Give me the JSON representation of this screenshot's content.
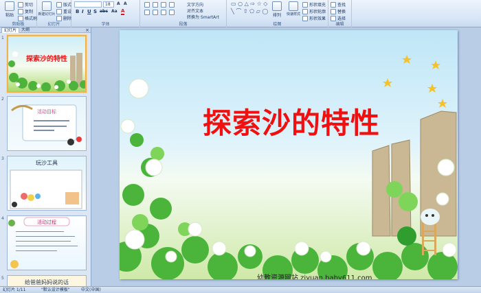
{
  "ribbon": {
    "groups": {
      "clipboard": "剪贴板",
      "slides": "幻灯片",
      "font": "字体",
      "paragraph": "段落",
      "drawing": "绘图",
      "editing": "编辑"
    },
    "paste_label": "粘贴",
    "cut_label": "剪切",
    "copy_label": "复制",
    "format_painter_label": "格式刷",
    "new_slide_label": "新建幻灯片",
    "layout_label": "版式",
    "reset_label": "重设",
    "delete_label": "删除",
    "font_size_value": "18",
    "text_direction_label": "文字方向",
    "align_text_label": "对齐文本",
    "smartart_label": "转换为 SmartArt",
    "arrange_label": "排列",
    "quick_styles_label": "快速样式",
    "shape_fill_label": "形状填充",
    "shape_outline_label": "形状轮廓",
    "shape_effects_label": "形状效果",
    "find_label": "查找",
    "replace_label": "替换",
    "select_label": "选择",
    "format_bold": "B",
    "format_italic": "I",
    "format_underline": "U",
    "format_strike": "S",
    "format_abc": "abc",
    "format_font_color": "A",
    "format_aa": "Aa"
  },
  "panel": {
    "tab_slides": "幻灯片",
    "tab_outline": "大纲"
  },
  "thumbnails": [
    {
      "number": "1",
      "title": "探索沙的特性"
    },
    {
      "number": "2",
      "title": "活动目标"
    },
    {
      "number": "3",
      "title": "玩沙工具"
    },
    {
      "number": "4",
      "title": "活动过程"
    },
    {
      "number": "5",
      "title": "给爸爸妈妈说的话"
    }
  ],
  "slide": {
    "title": "探索沙的特性",
    "footer": "幼教资源网站 ziyuan.baby611.com"
  },
  "status": {
    "slide_count": "幻灯片 1/11",
    "theme": "\"默认设计模板\"",
    "language": "中文(中国)"
  },
  "colors": {
    "title_red": "#f01010",
    "selected_border": "#f2b24a",
    "ribbon_bg": "#d7e5f6"
  }
}
